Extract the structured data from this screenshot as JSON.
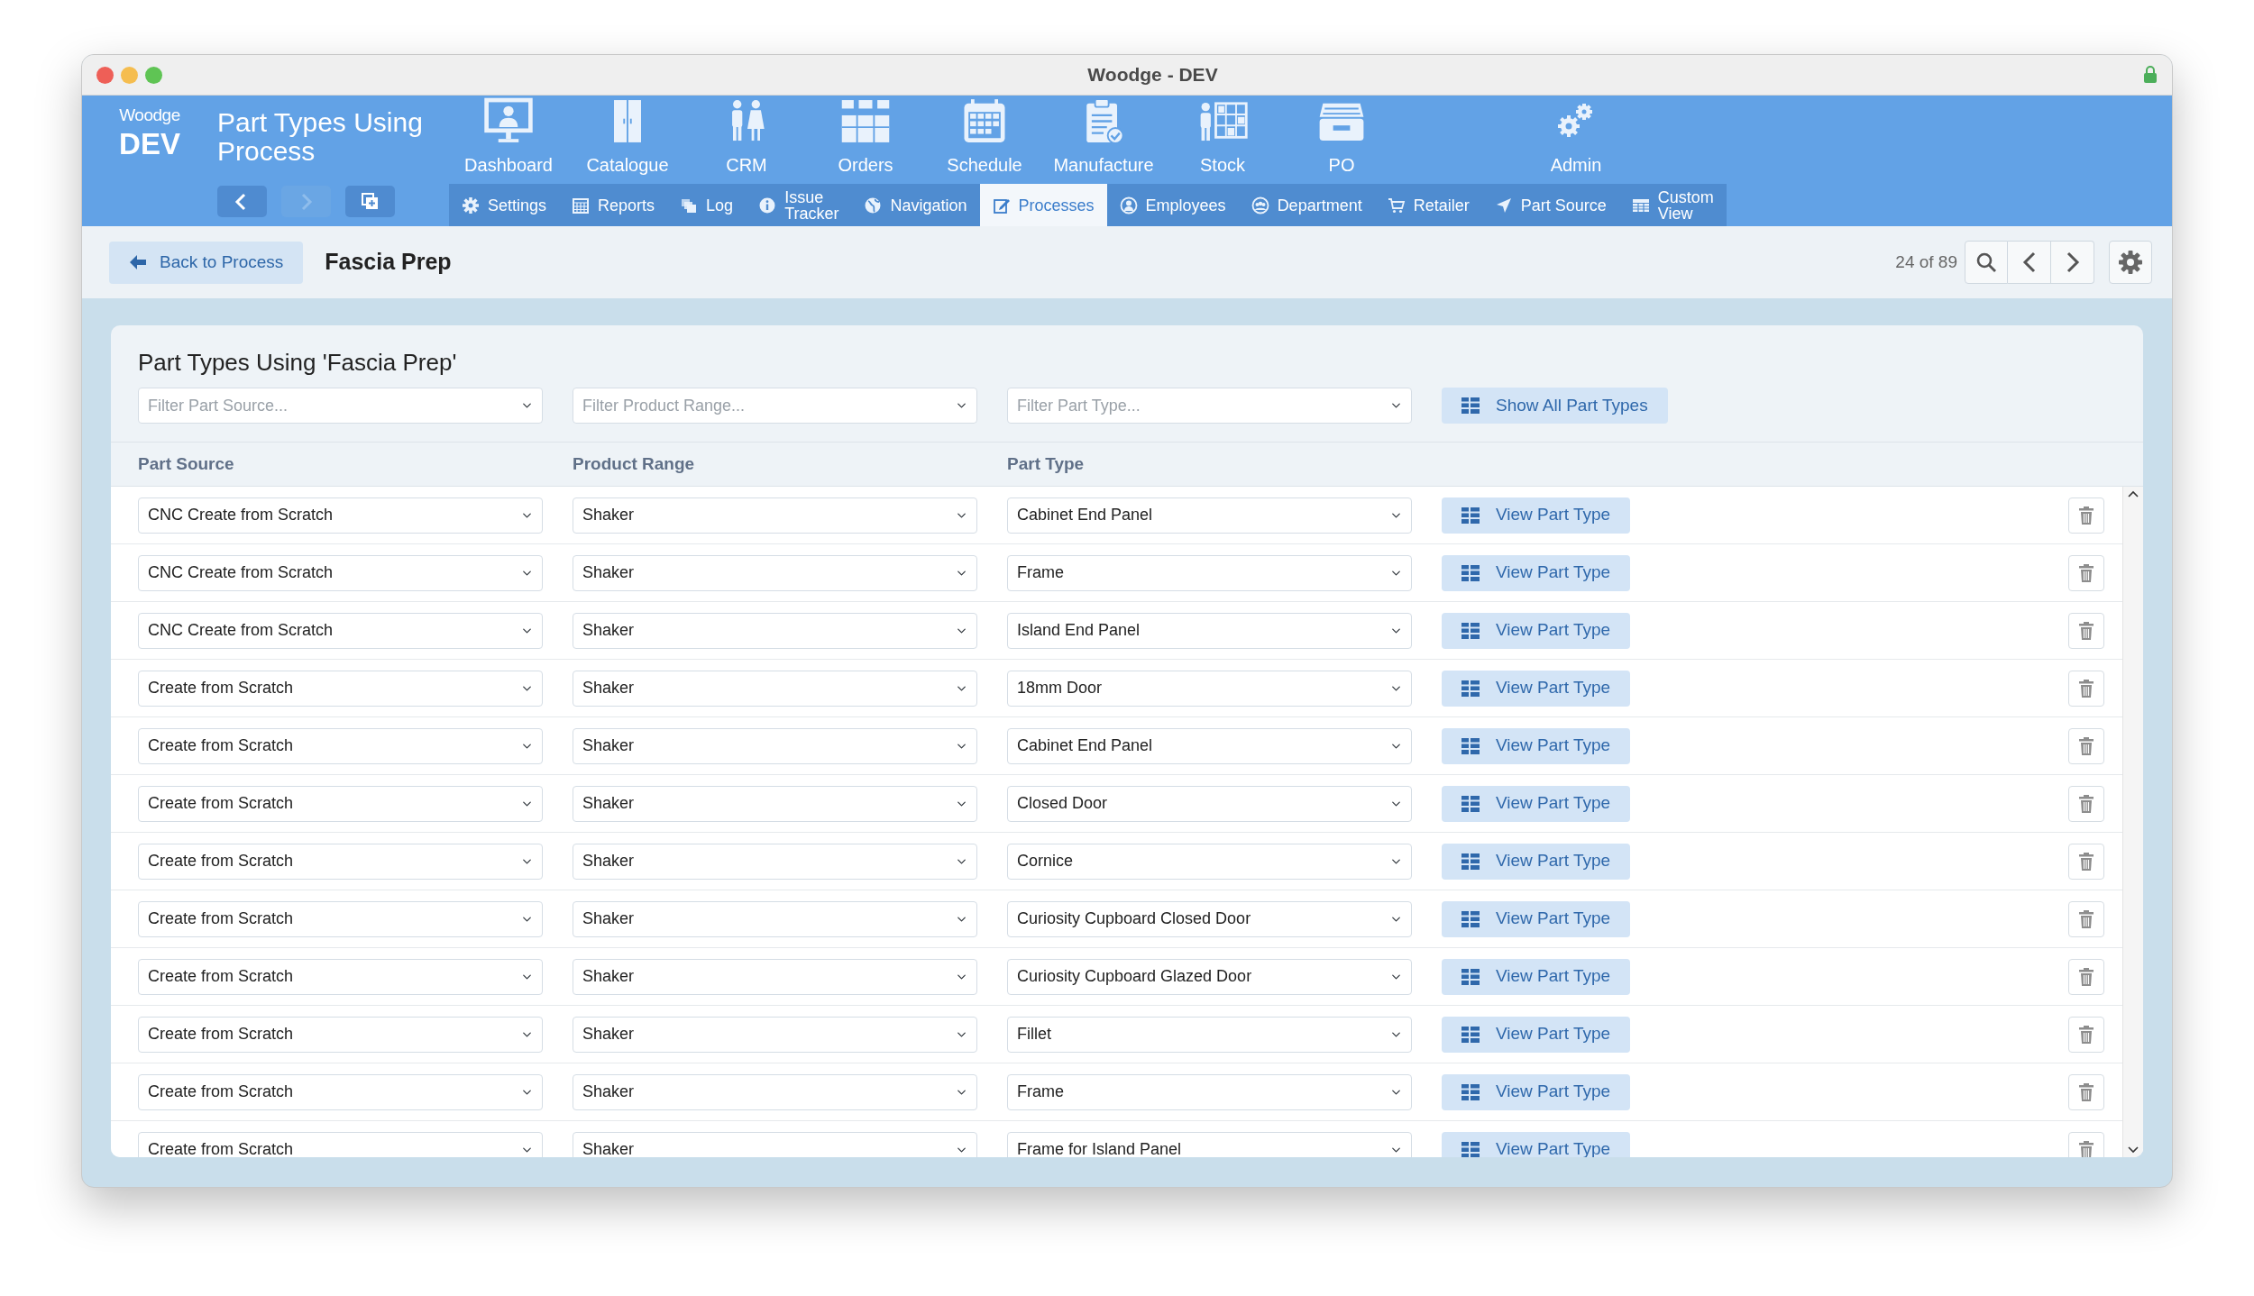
{
  "window": {
    "title": "Woodge - DEV"
  },
  "brand": {
    "name": "Woodge",
    "env": "DEV"
  },
  "page_title": "Part Types Using Process",
  "history_buttons": [
    {
      "kind": "back",
      "disabled": false
    },
    {
      "kind": "forward",
      "disabled": true
    },
    {
      "kind": "new-window",
      "disabled": false
    }
  ],
  "main_nav": [
    {
      "label": "Dashboard",
      "kind": "dashboard"
    },
    {
      "label": "Catalogue",
      "kind": "catalogue"
    },
    {
      "label": "CRM",
      "kind": "crm"
    },
    {
      "label": "Orders",
      "kind": "orders"
    },
    {
      "label": "Schedule",
      "kind": "schedule"
    },
    {
      "label": "Manufacture",
      "kind": "manufacture"
    },
    {
      "label": "Stock",
      "kind": "stock"
    },
    {
      "label": "PO",
      "kind": "po"
    }
  ],
  "admin_nav": {
    "label": "Admin"
  },
  "sub_nav": [
    {
      "label": "Settings",
      "kind": "settings",
      "selected": false
    },
    {
      "label": "Reports",
      "kind": "reports",
      "selected": false
    },
    {
      "label": "Log",
      "kind": "log",
      "selected": false
    },
    {
      "label": "Issue\nTracker",
      "kind": "info",
      "selected": false
    },
    {
      "label": "Navigation",
      "kind": "globe",
      "selected": false
    },
    {
      "label": "Processes",
      "kind": "edit",
      "selected": true
    },
    {
      "label": "Employees",
      "kind": "person",
      "selected": false
    },
    {
      "label": "Department",
      "kind": "group",
      "selected": false
    },
    {
      "label": "Retailer",
      "kind": "cart",
      "selected": false
    },
    {
      "label": "Part Source",
      "kind": "arrow",
      "selected": false
    },
    {
      "label": "Custom\nView",
      "kind": "table",
      "selected": false
    }
  ],
  "toolbar": {
    "back_button": "Back to Process",
    "record_title": "Fascia Prep",
    "position": "24 of 89"
  },
  "card": {
    "title": "Part Types Using 'Fascia Prep'",
    "filters": [
      {
        "placeholder": "Filter Part Source..."
      },
      {
        "placeholder": "Filter Product Range..."
      },
      {
        "placeholder": "Filter Part Type..."
      }
    ],
    "show_all_button": "Show All Part Types",
    "columns": [
      "Part Source",
      "Product Range",
      "Part Type"
    ],
    "rows": [
      {
        "part_source": "CNC Create from Scratch",
        "product_range": "Shaker",
        "part_type": "Cabinet End Panel",
        "action": "View Part Type"
      },
      {
        "part_source": "CNC Create from Scratch",
        "product_range": "Shaker",
        "part_type": "Frame",
        "action": "View Part Type"
      },
      {
        "part_source": "CNC Create from Scratch",
        "product_range": "Shaker",
        "part_type": "Island End Panel",
        "action": "View Part Type"
      },
      {
        "part_source": "Create from Scratch",
        "product_range": "Shaker",
        "part_type": "18mm Door",
        "action": "View Part Type"
      },
      {
        "part_source": "Create from Scratch",
        "product_range": "Shaker",
        "part_type": "Cabinet End Panel",
        "action": "View Part Type"
      },
      {
        "part_source": "Create from Scratch",
        "product_range": "Shaker",
        "part_type": "Closed Door",
        "action": "View Part Type"
      },
      {
        "part_source": "Create from Scratch",
        "product_range": "Shaker",
        "part_type": "Cornice",
        "action": "View Part Type"
      },
      {
        "part_source": "Create from Scratch",
        "product_range": "Shaker",
        "part_type": "Curiosity Cupboard Closed Door",
        "action": "View Part Type"
      },
      {
        "part_source": "Create from Scratch",
        "product_range": "Shaker",
        "part_type": "Curiosity Cupboard Glazed Door",
        "action": "View Part Type"
      },
      {
        "part_source": "Create from Scratch",
        "product_range": "Shaker",
        "part_type": "Fillet",
        "action": "View Part Type"
      },
      {
        "part_source": "Create from Scratch",
        "product_range": "Shaker",
        "part_type": "Frame",
        "action": "View Part Type"
      },
      {
        "part_source": "Create from Scratch",
        "product_range": "Shaker",
        "part_type": "Frame for Island Panel",
        "action": "View Part Type"
      }
    ]
  }
}
